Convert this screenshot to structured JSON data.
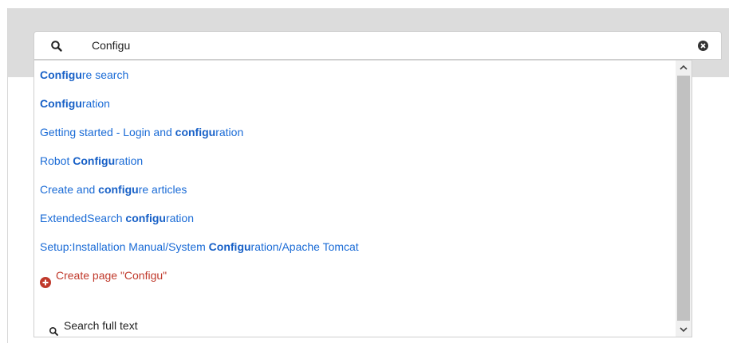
{
  "search": {
    "value": "Configu",
    "placeholder": ""
  },
  "suggestions": [
    {
      "pre": "",
      "match": "Configu",
      "post": "re search"
    },
    {
      "pre": "",
      "match": "Configu",
      "post": "ration"
    },
    {
      "pre": "Getting started - Login and ",
      "match": "configu",
      "post": "ration"
    },
    {
      "pre": "Robot ",
      "match": "Configu",
      "post": "ration"
    },
    {
      "pre": "Create and ",
      "match": "configu",
      "post": "re articles"
    },
    {
      "pre": "ExtendedSearch ",
      "match": "configu",
      "post": "ration"
    },
    {
      "pre": "Setup:Installation Manual/System ",
      "match": "Configu",
      "post": "ration/Apache Tomcat"
    }
  ],
  "create_page": {
    "label": "Create page \"Configu\"",
    "icon": "plus-circle-icon",
    "color": "#c0392b"
  },
  "full_text": {
    "label": "Search full text",
    "icon": "search-icon"
  },
  "colors": {
    "link": "#1a6bd6",
    "header_band": "#dcdcdc"
  }
}
